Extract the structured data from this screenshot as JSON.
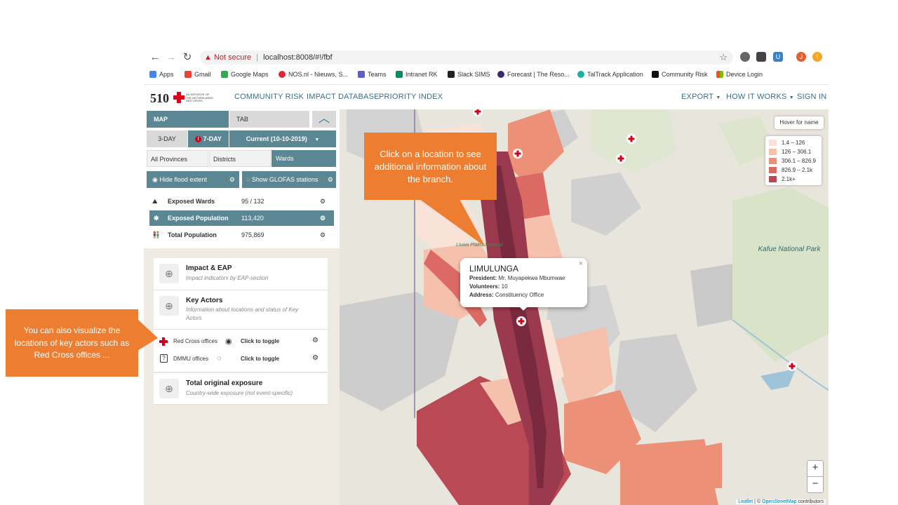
{
  "browser": {
    "not_secure": "Not secure",
    "url": "localhost:8008/#!/fbf",
    "bookmarks": [
      "Apps",
      "Gmail",
      "Google Maps",
      "NOS.nl - Nieuws, S...",
      "Teams",
      "Intranet RK",
      "Slack SIMS",
      "Forecast | The Reso...",
      "TalTrack Application",
      "Community Risk",
      "Device Login"
    ],
    "profile_initial": "J"
  },
  "header": {
    "logo_number": "510",
    "logo_caption": "AN INITIATIVE OF THE NETHERLANDS RED CROSS",
    "nav_left": [
      "COMMUNITY RISK",
      "IMPACT DATABASE",
      "PRIORITY INDEX"
    ],
    "nav_right": [
      "EXPORT",
      "HOW IT WORKS",
      "SIGN IN"
    ]
  },
  "panel": {
    "tab_map": "MAP",
    "tab_tab": "TAB",
    "day3": "3-DAY",
    "day7": "7-DAY",
    "current": "Current (10-10-2019)",
    "level_provinces": "All Provinces",
    "level_districts": "Districts",
    "level_wards": "Wards",
    "hide_flood": "Hide flood extent",
    "show_glofas": "Show GLOFAS stations",
    "stats": [
      {
        "label": "Exposed Wards",
        "value": "95 / 132"
      },
      {
        "label": "Exposed Population",
        "value": "113,420"
      },
      {
        "label": "Total Population",
        "value": "975,869"
      }
    ],
    "impact_title": "Impact & EAP",
    "impact_sub": "Impact indicators by EAP-section",
    "actors_title": "Key Actors",
    "actors_sub": "Information about locations and status of Key Actors",
    "rc_offices": "Red Cross offices",
    "dmmu_offices": "DMMU offices",
    "toggle_text": "Click to toggle",
    "total_title": "Total original exposure",
    "total_sub": "Country-wide exposure (not event-specific)"
  },
  "map": {
    "hover": "Hover for name",
    "legend": [
      "1.4 – 126",
      "126 – 306.1",
      "306.1 – 826.9",
      "826.9 – 2.1k",
      "2.1k+"
    ],
    "legend_colors": [
      "#f9e3d9",
      "#f5c1ad",
      "#ec9178",
      "#dc6a64",
      "#b94a55"
    ],
    "place_park": "Kafue National Park",
    "place_liuwa": "Liuwa Plains National",
    "popup_title": "LIMULUNGA",
    "popup_president_label": "President:",
    "popup_president": "Mr. Muyapekwa Mbumwae",
    "popup_volunteers_label": "Volunteers:",
    "popup_volunteers": "10",
    "popup_address_label": "Address:",
    "popup_address": "Constituency  Office",
    "zoom_in": "+",
    "zoom_out": "−",
    "attr_leaflet": "Leaflet",
    "attr_sep": " | © ",
    "attr_osm": "OpenStreetMap",
    "attr_tail": " contributors"
  },
  "callouts": {
    "top": "Click on a  location to see additional information about the branch.",
    "left": "You can also visualize the locations of key actors such as Red Cross offices ..."
  }
}
